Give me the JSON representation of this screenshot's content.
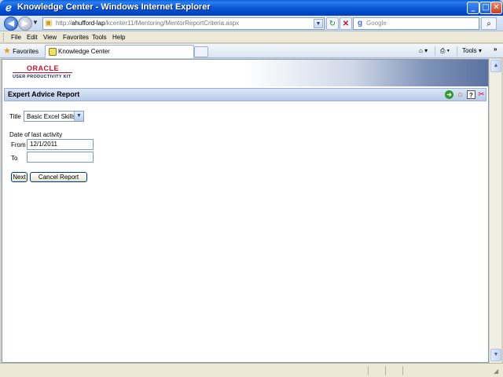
{
  "window": {
    "title": "Knowledge Center - Windows Internet Explorer",
    "buttons": {
      "minimize": "_",
      "maximize": "□",
      "close": "✕"
    }
  },
  "address_bar": {
    "url_prefix": "http://",
    "url_host": "ahufford-lap",
    "url_path": "/kcenter11/Mentoring/MentorReportCriteria.aspx",
    "search_placeholder": "Google"
  },
  "menu": {
    "items": [
      "File",
      "Edit",
      "View",
      "Favorites",
      "Tools",
      "Help"
    ]
  },
  "favorites_bar": {
    "favorites_label": "Favorites",
    "tab_title": "Knowledge Center",
    "tools_label": "Tools",
    "chevron": "»"
  },
  "banner": {
    "logo_text": "ORACLE",
    "product_name": "USER PRODUCTIVITY KIT"
  },
  "report": {
    "header_title": "Expert Advice Report",
    "title_label": "Title",
    "title_selected": "Basic Excel Skills",
    "date_label": "Date of last activity",
    "from_label": "From",
    "from_value": "12/1/2011",
    "to_label": "To",
    "to_value": "",
    "next_button": "Next",
    "cancel_button": "Cancel Report"
  },
  "icons": {
    "app": "ie-icon",
    "back": "back-arrow-icon",
    "forward": "forward-arrow-icon",
    "refresh": "refresh-icon",
    "stop": "stop-icon",
    "search": "search-icon",
    "favorites": "star-icon",
    "home": "home-icon",
    "print": "printer-icon",
    "go": "go-icon",
    "help": "help-icon",
    "exit": "exit-icon"
  },
  "colors": {
    "title_bar": "#0a5fd8",
    "oracle_red": "#c8102e",
    "section_header": "#c9d8ef"
  }
}
